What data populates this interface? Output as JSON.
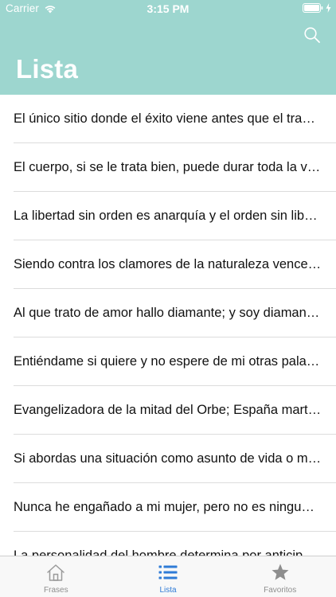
{
  "status_bar": {
    "carrier": "Carrier",
    "time": "3:15 PM"
  },
  "header": {
    "title": "Lista",
    "background_color": "#9dd6cf",
    "search_icon": "search-icon"
  },
  "list": {
    "items": [
      "El único sitio donde el éxito viene antes que el trabajo es en el diccionario.",
      "El cuerpo, si se le trata bien, puede durar toda la vida.",
      "La libertad sin orden es anarquía y el orden sin libertad es tiranía.",
      "Siendo contra los clamores de la naturaleza vencedores.",
      "Al que trato de amor hallo diamante; y soy diamante al que de amor me trata.",
      "Entiéndame si quiere y no espere de mi otras palabras.",
      "Evangelizadora de la mitad del Orbe; España martillo de herejes.",
      "Si abordas una situación como asunto de vida o muerte, morirás muchas veces.",
      "Nunca he engañado a mi mujer, pero no es ninguna virtud.",
      "La personalidad del hombre determina por anticipado la medida de su posible fortuna."
    ]
  },
  "tab_bar": {
    "active_color": "#2f7bd6",
    "inactive_color": "#8e8e8e",
    "tabs": [
      {
        "label": "Frases",
        "icon": "home-icon",
        "active": false
      },
      {
        "label": "Lista",
        "icon": "list-icon",
        "active": true
      },
      {
        "label": "Favoritos",
        "icon": "star-icon",
        "active": false
      }
    ]
  }
}
